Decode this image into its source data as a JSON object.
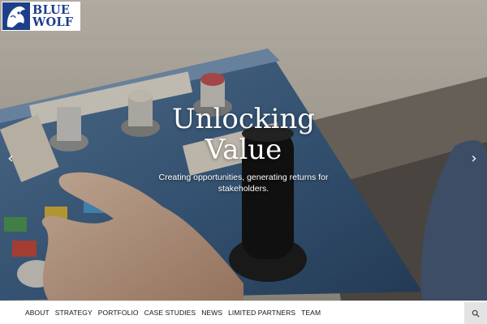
{
  "brand": {
    "logo_line1": "BLUE",
    "logo_line2": "WOLF",
    "logo_color": "#1d3f8a"
  },
  "hero": {
    "title_line1": "Unlocking",
    "title_line2": "Value",
    "subtitle": "Creating opportunities, generating returns for stakeholders.",
    "prev_icon": "chevron-left-icon",
    "next_icon": "chevron-right-icon"
  },
  "nav": {
    "items": [
      {
        "label": "ABOUT"
      },
      {
        "label": "STRATEGY"
      },
      {
        "label": "PORTFOLIO"
      },
      {
        "label": "CASE STUDIES"
      },
      {
        "label": "NEWS"
      },
      {
        "label": "LIMITED PARTNERS"
      },
      {
        "label": "TEAM"
      }
    ],
    "search_icon": "search-icon"
  }
}
